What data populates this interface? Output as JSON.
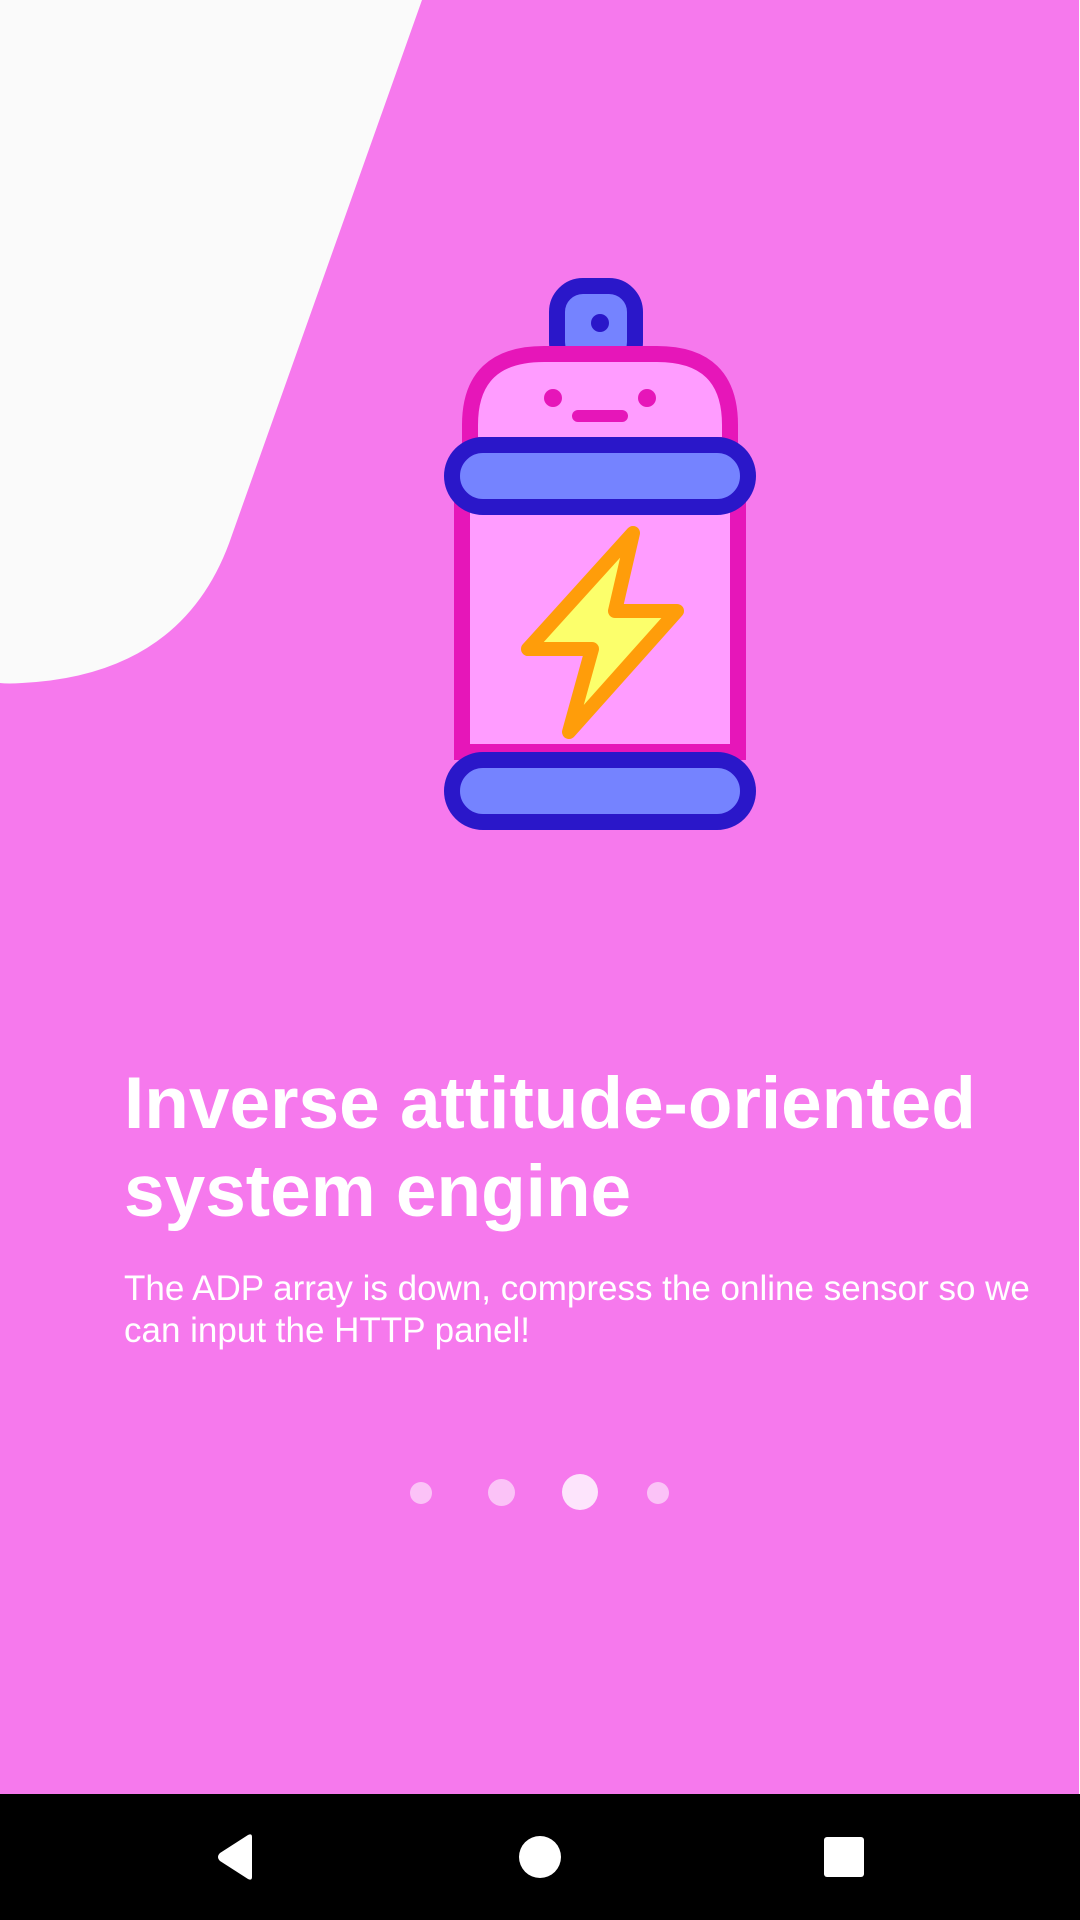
{
  "onboarding": {
    "title": "Inverse attitude-oriented system engine",
    "description": "The ADP array is down, compress the online sensor so we can input the HTTP panel!",
    "page_count": 4,
    "current_page": 3,
    "illustration_icon": "spray-can-lightning-icon"
  },
  "colors": {
    "background": "#f679ed",
    "blob": "#fafafa",
    "text": "#ffffff",
    "icon_outline_magenta": "#e616b9",
    "icon_outline_navy": "#2a17c9",
    "icon_band_fill": "#7583ff",
    "icon_body_fill": "#ff9cff",
    "bolt_outline": "#ff9d0a",
    "bolt_fill": "#fcff6b"
  },
  "nav_bar": {
    "back_icon": "back-triangle-icon",
    "home_icon": "home-circle-icon",
    "recents_icon": "recents-square-icon"
  }
}
